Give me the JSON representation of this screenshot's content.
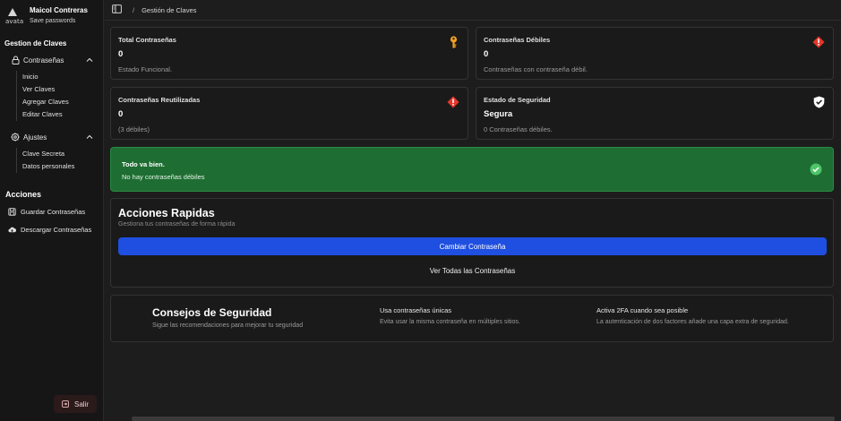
{
  "user": {
    "name": "Maicol Contreras",
    "subtitle": "Save passwords",
    "logo_text": "avata"
  },
  "sidebar": {
    "section_title": "Gestion de Claves",
    "groups": [
      {
        "label": "Contraseñas",
        "icon": "lock-icon",
        "items": [
          "Inicio",
          "Ver Claves",
          "Agregar Claves",
          "Editar Claves"
        ]
      },
      {
        "label": "Ajustes",
        "icon": "gear-icon",
        "items": [
          "Clave Secreta",
          "Datos personales"
        ]
      }
    ],
    "actions_title": "Acciones",
    "actions": [
      {
        "label": "Guardar Contraseñas",
        "icon": "save-icon"
      },
      {
        "label": "Descargar Contraseñas",
        "icon": "cloud-download-icon"
      }
    ],
    "logout_label": "Salir"
  },
  "header": {
    "breadcrumb_sep": "/",
    "breadcrumb_current": "Gestión de Claves"
  },
  "stats": [
    {
      "label": "Total Contraseñas",
      "value": "0",
      "desc": "Estado Funcional.",
      "icon": "key-icon",
      "color": "#f0a020"
    },
    {
      "label": "Contraseñas Débiles",
      "value": "0",
      "desc": "Contraseñas con contraseña débil.",
      "icon": "warning-diamond-icon",
      "color": "#e5372b"
    },
    {
      "label": "Contraseñas Reutilizadas",
      "value": "0",
      "desc": "(3 débiles)",
      "icon": "warning-diamond-icon",
      "color": "#e5372b"
    },
    {
      "label": "Estado de Seguridad",
      "value": "Segura",
      "desc": "0 Contraseñas débiles.",
      "icon": "shield-check-icon",
      "color": "#ffffff"
    }
  ],
  "alert": {
    "title": "Todo va bien.",
    "desc": "No hay contraseñas débiles",
    "color": "#1e6d32"
  },
  "quick": {
    "title": "Acciones Rapidas",
    "subtitle": "Gestiona tus contraseñas de forma rápida",
    "primary_label": "Cambiar Contraseña",
    "secondary_label": "Ver Todas las Contraseñas",
    "accent": "#1f4fe0"
  },
  "tips": {
    "title": "Consejos de Seguridad",
    "subtitle": "Sigue las recomendaciones para mejorar tu seguridad",
    "items": [
      {
        "title": "Usa contraseñas únicas",
        "desc": "Evita usar la misma contraseña en múltiples sitios."
      },
      {
        "title": "Activa 2FA cuando sea posible",
        "desc": "La autenticación de dos factores añade una capa extra de seguridad."
      }
    ]
  }
}
